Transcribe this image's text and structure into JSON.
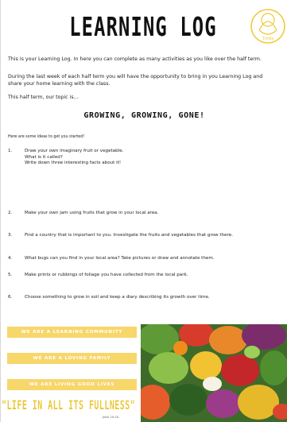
{
  "document": {
    "title": "LEARNING LOG",
    "logo_text": "Trinity",
    "intro": "This is your Learning Log. In here you can complete as many activities as you like over the half term.",
    "week_note": "During the last week of each half term you will have the opportunity to bring in you Learning Log and share your home learning with the class.",
    "topic_intro": "This half term, our topic is…",
    "topic": "GROWING, GROWING, GONE!",
    "ideas_intro": "Here are some ideas to get you started!",
    "ideas": [
      {
        "num": "1.",
        "lines": [
          "Draw your own imaginary fruit or vegetable.",
          "What is it called?",
          "Write down three interesting facts about it!"
        ]
      },
      {
        "num": "2.",
        "lines": [
          "Make your own jam using fruits that grow in your local area."
        ]
      },
      {
        "num": "3.",
        "lines": [
          "Find a country that is important to you. Investigate the fruits and vegetables that grow there."
        ]
      },
      {
        "num": "4.",
        "lines": [
          "What bugs can you find in your local area? Take pictures or draw and annotate them."
        ]
      },
      {
        "num": "5.",
        "lines": [
          "Make prints or rubbings of foliage you have collected from the local park."
        ]
      },
      {
        "num": "6.",
        "lines": [
          "Choose something to grow in soil and keep a diary describing its growth over time."
        ]
      }
    ],
    "values": [
      "WE ARE A LEARNING COMMUNITY",
      "WE ARE A LOVING FAMILY",
      "WE ARE LIVING GOOD LIVES"
    ],
    "motto": "\"LIFE IN ALL ITS FULLNESS\"",
    "motto_ref": "John 10:10",
    "colors": {
      "banner": "#f7d66a",
      "motto": "#ecc83a",
      "logo": "#f0c93c"
    }
  }
}
